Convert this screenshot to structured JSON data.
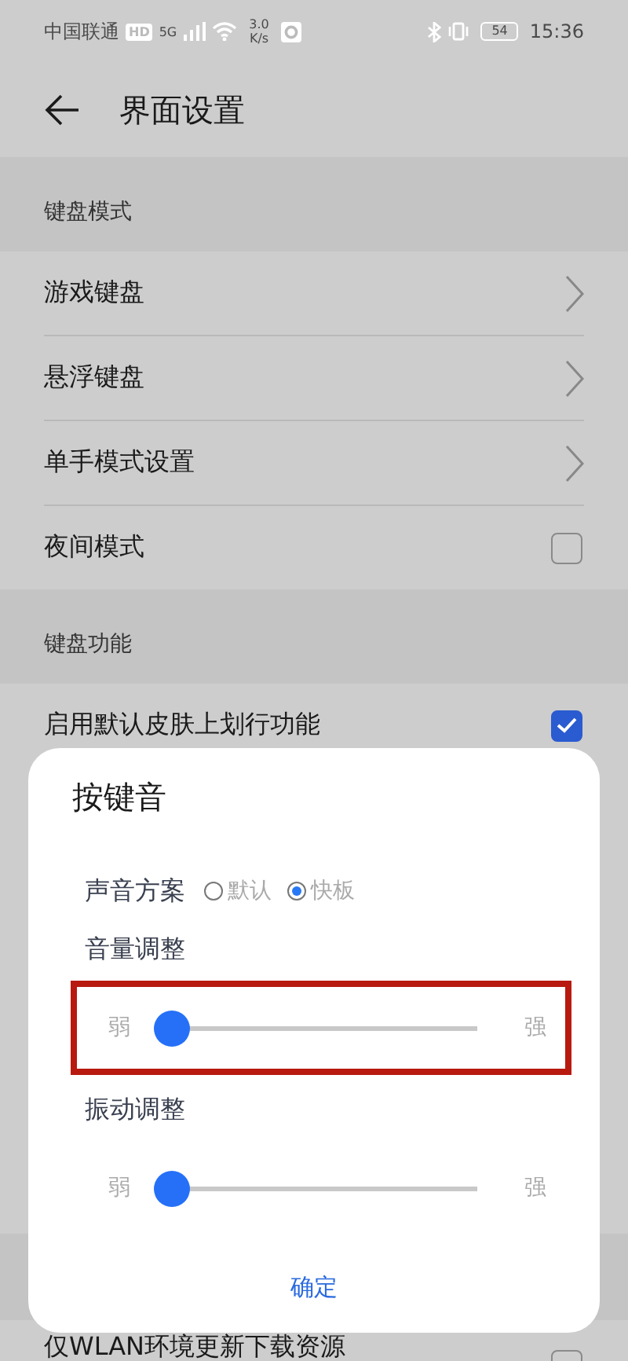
{
  "status_bar": {
    "carrier": "中国联通",
    "hd_badge": "HD",
    "network": "5G",
    "speed_value": "3.0",
    "speed_unit": "K/s",
    "battery": "54",
    "time": "15:36"
  },
  "header": {
    "title": "界面设置"
  },
  "sections": [
    {
      "title": "键盘模式",
      "items": [
        {
          "label": "游戏键盘",
          "kind": "link"
        },
        {
          "label": "悬浮键盘",
          "kind": "link"
        },
        {
          "label": "单手模式设置",
          "kind": "link"
        },
        {
          "label": "夜间模式",
          "kind": "checkbox",
          "checked": false
        }
      ]
    },
    {
      "title": "键盘功能",
      "items": [
        {
          "label": "启用默认皮肤上划行功能",
          "kind": "checkbox",
          "checked": true
        }
      ]
    },
    {
      "items": [
        {
          "label": "仅WLAN环境更新下载资源",
          "kind": "checkbox",
          "checked": false
        }
      ]
    }
  ],
  "dialog": {
    "title": "按键音",
    "scheme": {
      "label": "声音方案",
      "options": [
        {
          "label": "默认",
          "selected": false
        },
        {
          "label": "快板",
          "selected": true
        }
      ]
    },
    "sliders": [
      {
        "label": "音量调整",
        "min_label": "弱",
        "max_label": "强",
        "level": 0,
        "highlighted": true
      },
      {
        "label": "振动调整",
        "min_label": "弱",
        "max_label": "强",
        "level": 0,
        "highlighted": false
      }
    ],
    "confirm": "确定"
  }
}
